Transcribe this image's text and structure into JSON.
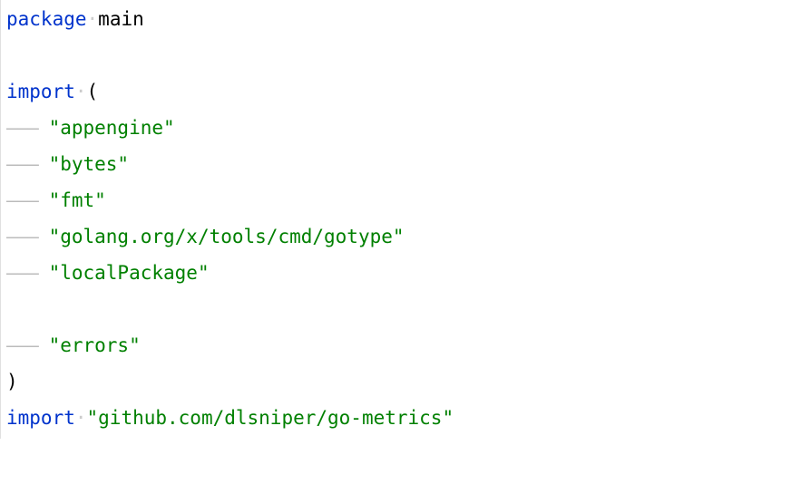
{
  "code": {
    "lines": [
      {
        "tokens": [
          {
            "type": "keyword",
            "text": "package"
          },
          {
            "type": "ws-dot",
            "text": "·"
          },
          {
            "type": "identifier",
            "text": "main"
          }
        ]
      },
      {
        "tokens": []
      },
      {
        "tokens": [
          {
            "type": "keyword",
            "text": "import"
          },
          {
            "type": "ws-dot",
            "text": "·"
          },
          {
            "type": "paren",
            "text": "("
          }
        ]
      },
      {
        "tokens": [
          {
            "type": "indent-guide",
            "text": "——— "
          },
          {
            "type": "string",
            "text": "\"appengine\""
          }
        ]
      },
      {
        "tokens": [
          {
            "type": "indent-guide",
            "text": "——— "
          },
          {
            "type": "string",
            "text": "\"bytes\""
          }
        ]
      },
      {
        "tokens": [
          {
            "type": "indent-guide",
            "text": "——— "
          },
          {
            "type": "string",
            "text": "\"fmt\""
          }
        ]
      },
      {
        "tokens": [
          {
            "type": "indent-guide",
            "text": "——— "
          },
          {
            "type": "string",
            "text": "\"golang.org/x/tools/cmd/gotype\""
          }
        ]
      },
      {
        "tokens": [
          {
            "type": "indent-guide",
            "text": "——— "
          },
          {
            "type": "string",
            "text": "\"localPackage\""
          }
        ]
      },
      {
        "tokens": []
      },
      {
        "tokens": [
          {
            "type": "indent-guide",
            "text": "——— "
          },
          {
            "type": "string",
            "text": "\"errors\""
          }
        ]
      },
      {
        "tokens": [
          {
            "type": "paren",
            "text": ")"
          }
        ]
      },
      {
        "tokens": [
          {
            "type": "keyword",
            "text": "import"
          },
          {
            "type": "ws-dot",
            "text": "·"
          },
          {
            "type": "string",
            "text": "\"github.com/dlsniper/go-metrics\""
          }
        ]
      }
    ]
  }
}
